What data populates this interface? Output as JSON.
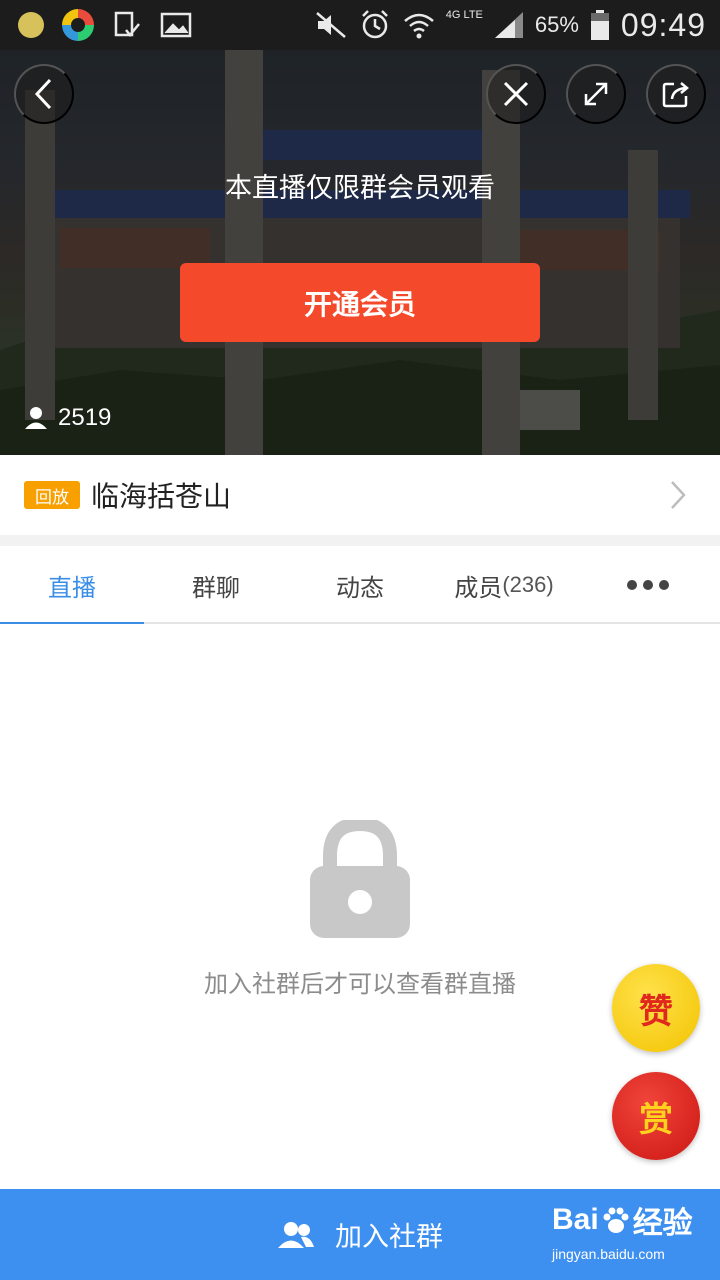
{
  "status_bar": {
    "network": "4G LTE",
    "battery": "65%",
    "time": "09:49"
  },
  "hero": {
    "notice": "本直播仅限群会员观看",
    "member_button": "开通会员",
    "viewer_count": "2519"
  },
  "title_row": {
    "badge": "回放",
    "title": "临海括苍山"
  },
  "tabs": [
    {
      "label": "直播",
      "count": ""
    },
    {
      "label": "群聊",
      "count": ""
    },
    {
      "label": "动态",
      "count": ""
    },
    {
      "label": "成员",
      "count": "(236)"
    }
  ],
  "locked": {
    "message": "加入社群后才可以查看群直播"
  },
  "floating": {
    "like": "赞",
    "reward": "赏"
  },
  "bottom": {
    "join_label": "加入社群"
  },
  "watermark": {
    "brand_left": "Bai",
    "brand_right": "经验",
    "url": "jingyan.baidu.com"
  },
  "colors": {
    "accent_blue": "#3a8ee6",
    "bottom_blue": "#3d8ff0",
    "member_red": "#f5492c",
    "badge_orange": "#f7a000"
  }
}
